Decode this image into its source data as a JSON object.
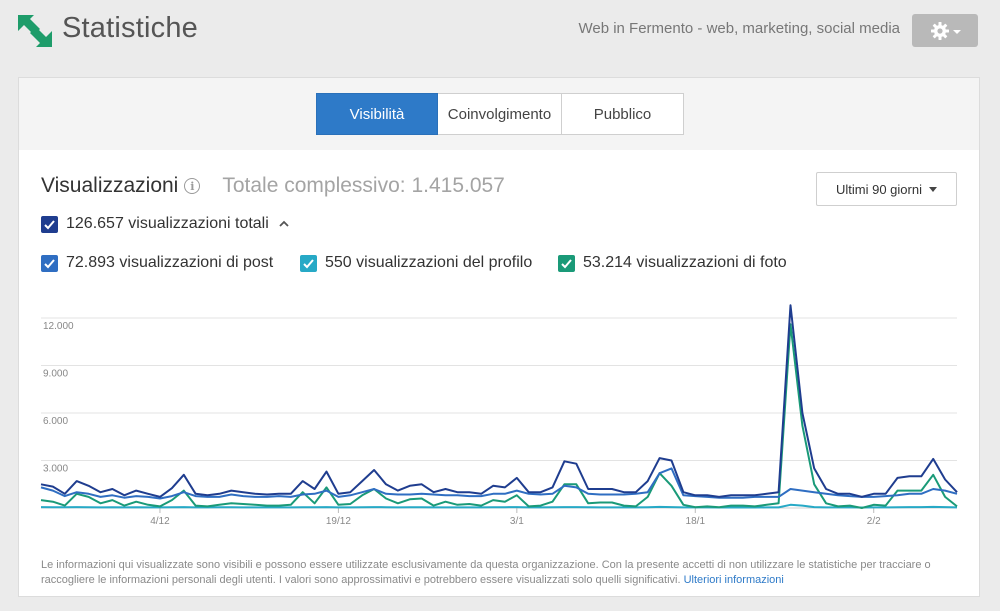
{
  "header": {
    "title": "Statistiche",
    "page_name": "Web in Fermento - web, marketing, social media",
    "settings_icon": "gear-icon"
  },
  "tabs": [
    {
      "label": "Visibilità",
      "active": true
    },
    {
      "label": "Coinvolgimento",
      "active": false
    },
    {
      "label": "Pubblico",
      "active": false
    }
  ],
  "section": {
    "title": "Visualizzazioni",
    "total_label": "Totale complessivo: 1.415.057",
    "range_label": "Ultimi 90 giorni"
  },
  "checkboxes": {
    "total": {
      "label": "126.657 visualizzazioni totali",
      "checked": true,
      "color": "#1f3d8f"
    },
    "post": {
      "label": "72.893 visualizzazioni di post",
      "checked": true,
      "color": "#2f6ec2"
    },
    "profile": {
      "label": "550 visualizzazioni del profilo",
      "checked": true,
      "color": "#27a9c6"
    },
    "photo": {
      "label": "53.214 visualizzazioni di foto",
      "checked": true,
      "color": "#1a9a78"
    }
  },
  "chart_data": {
    "type": "line",
    "y_ticks": [
      "3.000",
      "6.000",
      "9.000",
      "12.000"
    ],
    "x_ticks": [
      "4/12",
      "19/12",
      "3/1",
      "18/1",
      "2/2"
    ],
    "ylim": [
      0,
      12000
    ],
    "grid": true,
    "series": [
      {
        "name": "126.657 visualizzazioni totali",
        "color": "#1f3d8f",
        "values": [
          1500,
          1350,
          900,
          1700,
          1400,
          1000,
          1200,
          800,
          1100,
          900,
          700,
          1250,
          2100,
          900,
          800,
          900,
          1100,
          1000,
          900,
          850,
          900,
          900,
          1700,
          1200,
          2300,
          900,
          1000,
          1700,
          2400,
          1500,
          1100,
          1400,
          1500,
          1000,
          1200,
          1000,
          1000,
          900,
          1400,
          1300,
          1900,
          1000,
          1000,
          1300,
          2950,
          2800,
          1200,
          1200,
          1200,
          1000,
          1000,
          1700,
          3150,
          3000,
          1000,
          800,
          800,
          700,
          800,
          800,
          800,
          900,
          1000,
          12800,
          6000,
          2500,
          1200,
          900,
          900,
          700,
          900,
          900,
          1900,
          2000,
          2000,
          3100,
          1800,
          1000
        ]
      },
      {
        "name": "72.893 visualizzazioni di post",
        "color": "#2f6ec2",
        "values": [
          1300,
          1100,
          750,
          1000,
          900,
          700,
          800,
          650,
          750,
          700,
          600,
          750,
          1000,
          750,
          700,
          700,
          850,
          750,
          700,
          700,
          750,
          700,
          850,
          900,
          1100,
          700,
          800,
          1000,
          1200,
          900,
          850,
          850,
          900,
          850,
          800,
          800,
          750,
          750,
          900,
          900,
          1100,
          900,
          850,
          900,
          1400,
          1300,
          900,
          850,
          850,
          850,
          900,
          1000,
          2200,
          2500,
          800,
          750,
          700,
          650,
          650,
          650,
          700,
          700,
          700,
          1200,
          1100,
          1000,
          900,
          800,
          750,
          700,
          700,
          750,
          800,
          900,
          900,
          1200,
          1100,
          900
        ]
      },
      {
        "name": "550 visualizzazioni del profilo",
        "color": "#27a9c6",
        "values": [
          60,
          50,
          50,
          60,
          50,
          40,
          50,
          40,
          50,
          40,
          40,
          50,
          60,
          40,
          40,
          50,
          50,
          40,
          40,
          40,
          40,
          40,
          50,
          50,
          60,
          40,
          40,
          50,
          60,
          50,
          40,
          50,
          50,
          40,
          40,
          40,
          40,
          40,
          50,
          50,
          60,
          40,
          40,
          50,
          60,
          60,
          50,
          40,
          40,
          40,
          40,
          50,
          70,
          60,
          40,
          40,
          40,
          30,
          30,
          30,
          30,
          40,
          40,
          200,
          150,
          60,
          40,
          40,
          40,
          30,
          40,
          40,
          50,
          60,
          60,
          70,
          60,
          40
        ]
      },
      {
        "name": "53.214 visualizzazioni di foto",
        "color": "#1a9a78",
        "values": [
          500,
          400,
          150,
          900,
          700,
          300,
          500,
          150,
          400,
          200,
          100,
          500,
          1100,
          150,
          100,
          200,
          300,
          250,
          200,
          150,
          150,
          200,
          1000,
          300,
          1300,
          200,
          250,
          800,
          1200,
          600,
          300,
          550,
          600,
          150,
          400,
          200,
          250,
          150,
          500,
          400,
          800,
          100,
          150,
          400,
          1500,
          1500,
          300,
          350,
          350,
          150,
          100,
          700,
          2200,
          1400,
          200,
          50,
          100,
          50,
          150,
          150,
          100,
          200,
          300,
          11600,
          5200,
          1500,
          300,
          100,
          150,
          0,
          200,
          150,
          1100,
          1100,
          1100,
          2100,
          700,
          100
        ]
      }
    ]
  },
  "footer": {
    "note": "Le informazioni qui visualizzate sono visibili e possono essere utilizzate esclusivamente da questa organizzazione. Con la presente accetti di non utilizzare le statistiche per tracciare o raccogliere le informazioni personali degli utenti. I valori sono approssimativi e potrebbero essere visualizzati solo quelli significativi.",
    "link_label": "Ulteriori informazioni"
  }
}
